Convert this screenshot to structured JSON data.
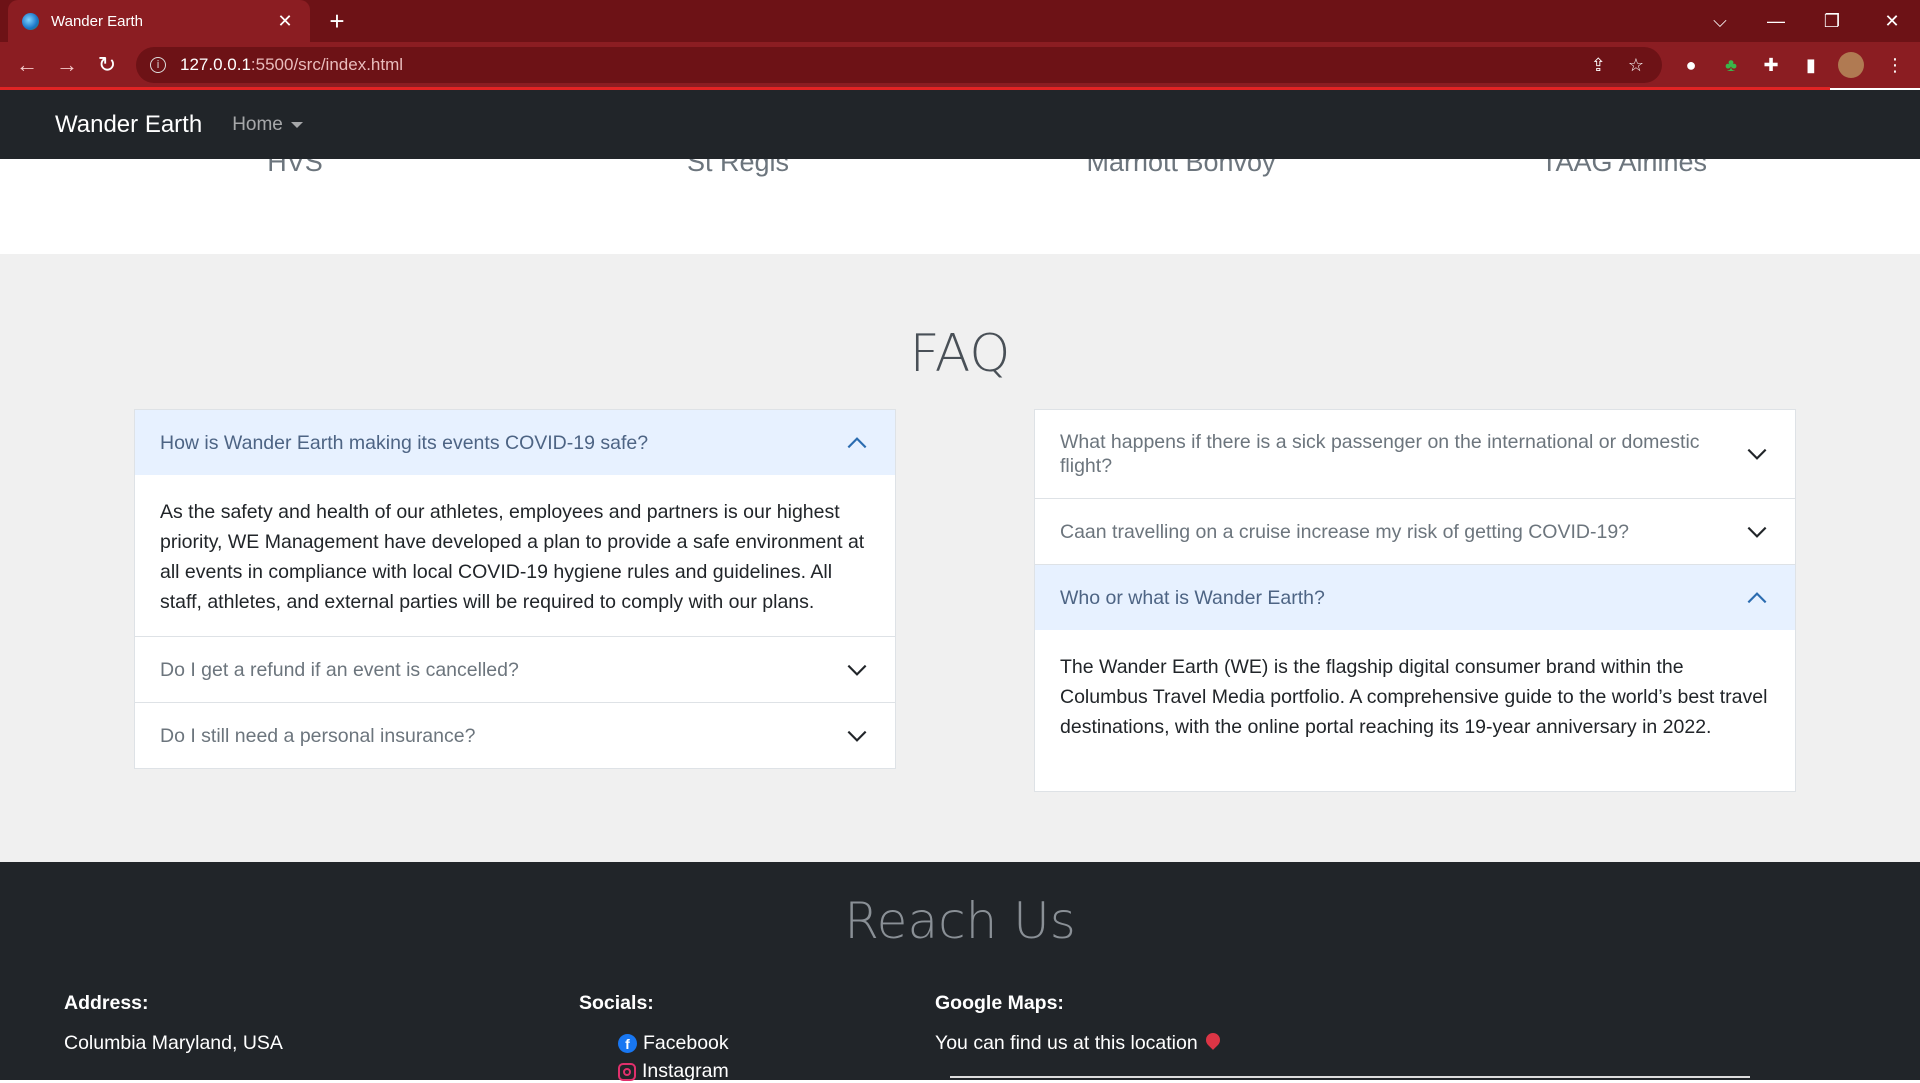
{
  "browser": {
    "tab_title": "Wander Earth",
    "url_host": "127.0.0.1",
    "url_path": ":5500/src/index.html"
  },
  "navbar": {
    "brand": "Wander Earth",
    "home": "Home"
  },
  "partners": [
    "HVS",
    "St Regis",
    "Marriott Bonvoy",
    "TAAG Airlines"
  ],
  "faq": {
    "title": "FAQ",
    "left": [
      {
        "question": "How is Wander Earth making its events COVID-19 safe?",
        "expanded": true,
        "answer": "As the safety and health of our athletes, employees and partners is our highest priority, WE Management have developed a plan to provide a safe environment at all events in compliance with local COVID-19 hygiene rules and guidelines. All staff, athletes, and external parties will be required to comply with our plans."
      },
      {
        "question": "Do I get a refund if an event is cancelled?",
        "expanded": false
      },
      {
        "question": "Do I still need a personal insurance?",
        "expanded": false
      }
    ],
    "right": [
      {
        "question": "What happens if there is a sick passenger on the international or domestic flight?",
        "expanded": false
      },
      {
        "question": "Caan travelling on a cruise increase my risk of getting COVID-19?",
        "expanded": false
      },
      {
        "question": "Who or what is Wander Earth?",
        "expanded": true,
        "answer": "The Wander Earth (WE) is the flagship digital consumer brand within the Columbus Travel Media portfolio. A comprehensive guide to the world’s best travel destinations, with the online portal reaching its 19-year anniversary in 2022."
      }
    ]
  },
  "footer": {
    "title": "Reach Us",
    "address_heading": "Address:",
    "address": "Columbia Maryland, USA",
    "socials_heading": "Socials:",
    "facebook": "Facebook",
    "instagram": "Instagram",
    "maps_heading": "Google Maps:",
    "maps_text": "You can find us at this location"
  },
  "colors": {
    "browser_frame": "#8b1d22",
    "navbar_bg": "#212529",
    "faq_bg": "#f0f0f0",
    "accordion_open_bg": "#e7f1ff",
    "accent_pin": "#dc3545"
  }
}
